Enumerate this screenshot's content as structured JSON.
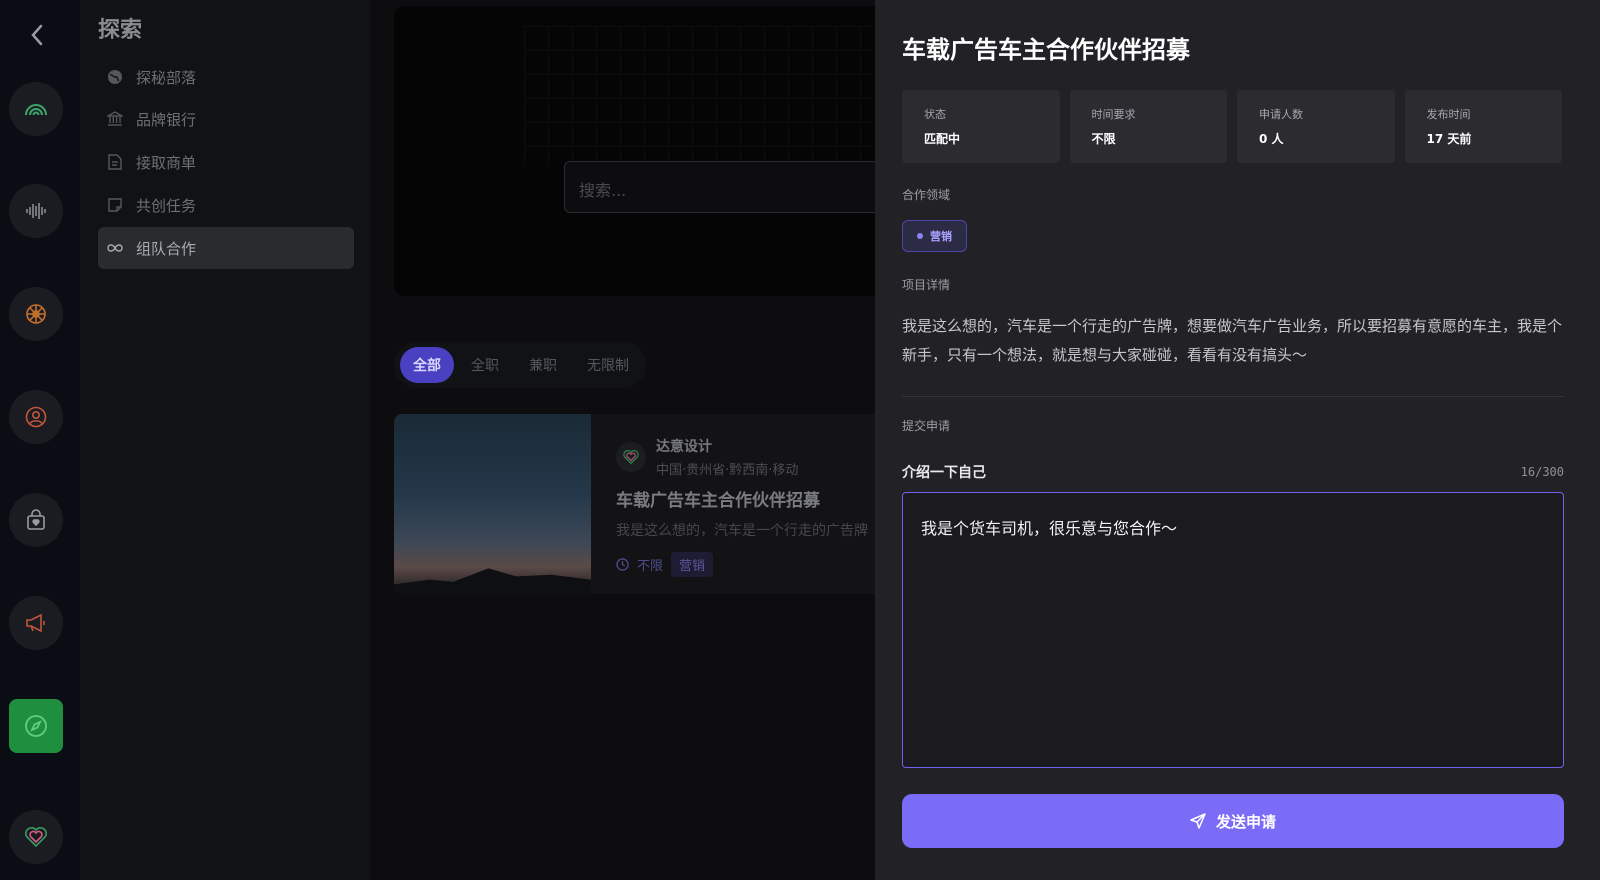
{
  "nav": {
    "title": "探索",
    "items": [
      {
        "label": "探秘部落",
        "icon": "globe-icon"
      },
      {
        "label": "品牌银行",
        "icon": "bank-icon"
      },
      {
        "label": "接取商单",
        "icon": "document-icon"
      },
      {
        "label": "共创任务",
        "icon": "sticky-note-icon"
      },
      {
        "label": "组队合作",
        "icon": "infinity-icon"
      }
    ]
  },
  "main": {
    "search_placeholder": "搜索...",
    "filters": [
      "全部",
      "全职",
      "兼职",
      "无限制"
    ],
    "card": {
      "org_name": "达意设计",
      "org_location": "中国·贵州省·黔西南·移动",
      "title": "车载广告车主合作伙伴招募",
      "desc": "我是这么想的，汽车是一个行走的广告牌",
      "time": "不限",
      "tag": "营销"
    }
  },
  "panel": {
    "title": "车载广告车主合作伙伴招募",
    "stats": [
      {
        "label": "状态",
        "value": "匹配中"
      },
      {
        "label": "时间要求",
        "value": "不限"
      },
      {
        "label": "申请人数",
        "value": "0 人"
      },
      {
        "label": "发布时间",
        "value": "17 天前"
      }
    ],
    "field_label": "合作领域",
    "field_tag": "营销",
    "detail_label": "项目详情",
    "detail_text": "我是这么想的，汽车是一个行走的广告牌，想要做汽车广告业务，所以要招募有意愿的车主，我是个新手，只有一个想法，就是想与大家碰碰，看看有没有搞头～",
    "submit_label": "提交申请",
    "intro_label": "介绍一下自己",
    "counter": "16/300",
    "intro_value": "我是个货车司机，很乐意与您合作～",
    "send_label": "发送申请"
  },
  "colors": {
    "accent": "#7b6cf8",
    "rail_active": "#1f8f3f",
    "panel_bg": "#222226"
  }
}
